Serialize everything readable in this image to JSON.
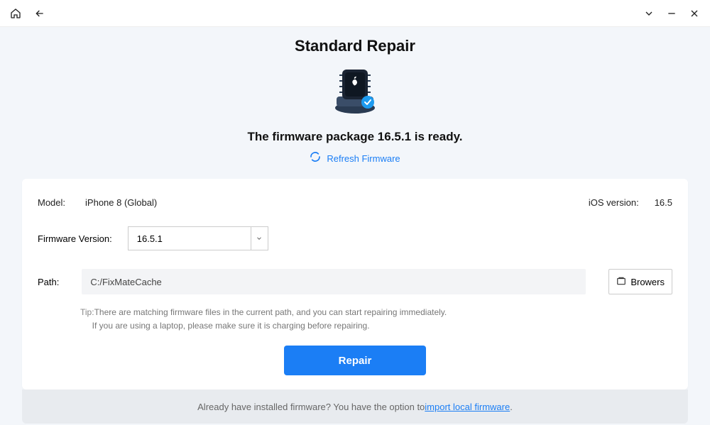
{
  "header": {
    "title": "Standard Repair",
    "status_line": "The firmware package 16.5.1 is ready.",
    "refresh_label": "Refresh Firmware"
  },
  "device": {
    "model_label": "Model:",
    "model_value": "iPhone 8 (Global)",
    "ios_label": "iOS version:",
    "ios_value": "16.5"
  },
  "firmware": {
    "version_label": "Firmware Version:",
    "version_value": "16.5.1"
  },
  "path": {
    "label": "Path:",
    "value": "C:/FixMateCache",
    "browse_label": "Browers"
  },
  "tips": {
    "prefix": "Tip:",
    "line1": "There are matching firmware files in the current path, and you can start repairing immediately.",
    "line2": "If you are using a laptop, please make sure it is charging before repairing."
  },
  "actions": {
    "repair_label": "Repair"
  },
  "footer": {
    "prefix": "Already have installed firmware? You have the option to ",
    "link": "import local firmware",
    "suffix": "."
  }
}
